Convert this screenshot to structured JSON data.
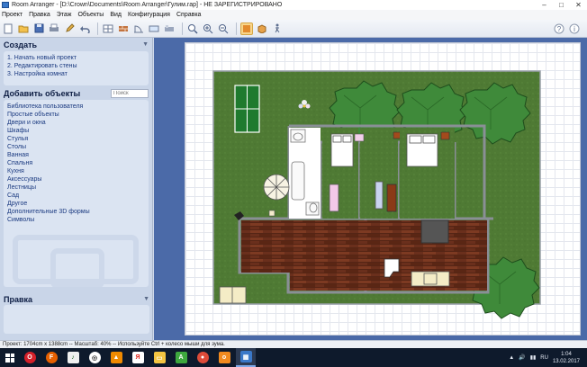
{
  "window": {
    "title": "Room Arranger - [D:\\Crown\\Documents\\Room Arranger\\Гулим.rap] - НЕ ЗАРЕГИСТРИРОВАНО",
    "minimize": "–",
    "maximize": "□",
    "close": "✕"
  },
  "menu": [
    "Проект",
    "Правка",
    "Этаж",
    "Объекты",
    "Вид",
    "Конфигурация",
    "Справка"
  ],
  "toolbar": {
    "icons": [
      "new-icon",
      "open-icon",
      "save-icon",
      "print-icon",
      "undo-icon",
      "pencil-icon",
      "floor-icon",
      "wall-icon",
      "door-icon",
      "window-icon",
      "furniture-icon",
      "zoom-fit-icon",
      "zoom-in-icon",
      "zoom-out-icon",
      "view-2d-icon",
      "view-3d-icon",
      "walk-icon"
    ],
    "right_icons": [
      "help-icon",
      "info-icon"
    ]
  },
  "left_panel": {
    "create": {
      "title": "Создать",
      "links": [
        "1. Начать новый проект",
        "2. Редактировать стены",
        "3. Настройка комнат"
      ]
    },
    "add_objects": {
      "title": "Добавить объекты",
      "search_placeholder": "Поиск",
      "categories": [
        "Библиотека пользователя",
        "Простые объекты",
        "Двери и окна",
        "Шкафы",
        "Стулья",
        "Столы",
        "Ванная",
        "Спальня",
        "Кухня",
        "Аксессуары",
        "Лестницы",
        "Сад",
        "Другое",
        "Дополнительные 3D формы",
        "Символы"
      ]
    },
    "properties": {
      "title": "Правка"
    }
  },
  "status_bar": {
    "text": "Проект: 1704cm x 1388cm -- Масштаб: 40% -- Используйте Ctrl + колесо мыши для зума."
  },
  "taskbar": {
    "apps": [
      "windows-start-icon",
      "opera-icon",
      "firefox-icon",
      "music-icon",
      "app-icon",
      "vlc-icon",
      "yandex-icon",
      "folder-icon",
      "android-icon",
      "chrome-icon",
      "ok-icon",
      "room-arranger-icon"
    ],
    "tray": {
      "lang": "RU",
      "time": "1:04",
      "date": "13.02.2017"
    }
  },
  "colors": {
    "grass": "#4f7a34",
    "wood_floor": "#6a2f1c",
    "tree": "#3f8a3a"
  }
}
